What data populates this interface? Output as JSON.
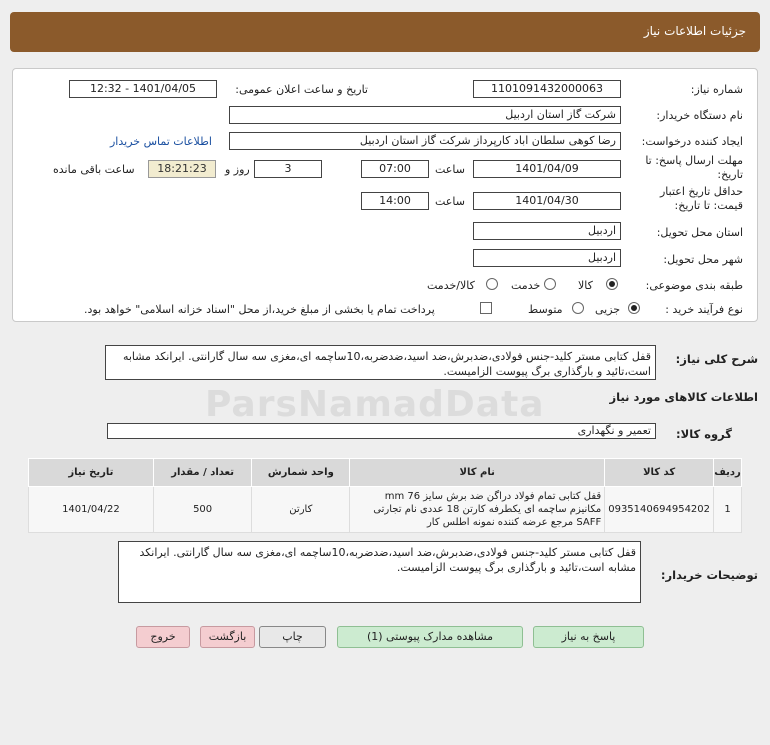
{
  "header": {
    "title": "جزئیات اطلاعات نیاز"
  },
  "labels": {
    "need_number": "شماره نیاز:",
    "announce_datetime": "تاریخ و ساعت اعلان عمومی:",
    "buyer_org": "نام دستگاه خریدار:",
    "requester": "ایجاد کننده درخواست:",
    "buyer_contact": "اطلاعات تماس خریدار",
    "reply_deadline": "مهلت ارسال پاسخ: تا تاریخ:",
    "time": "ساعت",
    "day_and": "روز و",
    "remaining": "ساعت باقی مانده",
    "price_validity": "حداقل تاریخ اعتبار قیمت: تا تاریخ:",
    "delivery_province": "استان محل تحویل:",
    "delivery_city": "شهر محل تحویل:",
    "category": "طبقه بندی موضوعی:",
    "purchase_type": "نوع فرآیند خرید :",
    "overall_desc": "شرح کلی نیاز:",
    "goods_info": "اطلاعات کالاهای مورد نیاز",
    "goods_group": "گروه کالا:",
    "buyer_notes": "توضیحات خریدار:"
  },
  "values": {
    "need_number": "1101091432000063",
    "announce_datetime": "1401/04/05 - 12:32",
    "buyer_org": "شرکت گاز استان اردبیل",
    "requester": "رضا کوهی سلطان اباد کارپرداز شرکت گاز استان اردبیل",
    "reply_date": "1401/04/09",
    "reply_time": "07:00",
    "days": "3",
    "remaining_time": "18:21:23",
    "validity_date": "1401/04/30",
    "validity_time": "14:00",
    "province": "اردبیل",
    "city": "اردبیل",
    "goods_group": "تعمیر و نگهداری"
  },
  "category_options": {
    "goods": "کالا",
    "service": "خدمت",
    "goods_service": "کالا/خدمت"
  },
  "purchase_options": {
    "partial": "جزیی",
    "medium": "متوسط",
    "treasury_note": "پرداخت تمام یا بخشی از مبلغ خرید،از محل \"اسناد خزانه اسلامی\" خواهد بود."
  },
  "overall_desc_text": "قفل کتابی مستر کلید-جنس فولادی،ضدبرش،ضد اسید،ضدضربه،10ساچمه ای،مغزی  سه سال گارانتی. ایرانکد مشابه است،تائید و بارگذاری برگ پیوست الزامیست.",
  "table": {
    "headers": [
      "ردیف",
      "کد کالا",
      "نام کالا",
      "واحد شمارش",
      "تعداد / مقدار",
      "تاریخ نیاز"
    ],
    "rows": [
      {
        "row": "1",
        "code": "0935140694954202",
        "name": "قفل کتابی تمام فولاد دراگن ضد برش سایز mm 76 مکانیزم ساچمه ای یکطرفه کارتن 18 عددی نام تجارتی SAFF مرجع عرضه کننده نمونه اطلس کار",
        "unit": "کارتن",
        "qty": "500",
        "date": "1401/04/22"
      }
    ]
  },
  "buyer_notes_text": "قفل کتابی مستر کلید-جنس فولادی،ضدبرش،ضد اسید،ضدضربه،10ساچمه ای،مغزی  سه سال گارانتی. ایرانکد مشابه است،تائید و بارگذاری برگ پیوست الزامیست.",
  "buttons": {
    "reply": "پاسخ به نیاز",
    "attachments": "مشاهده مدارک پیوستی (1)",
    "print": "چاپ",
    "back": "بازگشت",
    "exit": "خروج"
  },
  "watermark": {
    "brand": "ParsNamadData"
  },
  "colors": {
    "header_bg": "#8b5a2b",
    "timer_bg": "#f2ecd0",
    "link": "#1a4fa0",
    "reply_btn": "#ccebd0",
    "exit_btn": "#f4cdd0"
  }
}
